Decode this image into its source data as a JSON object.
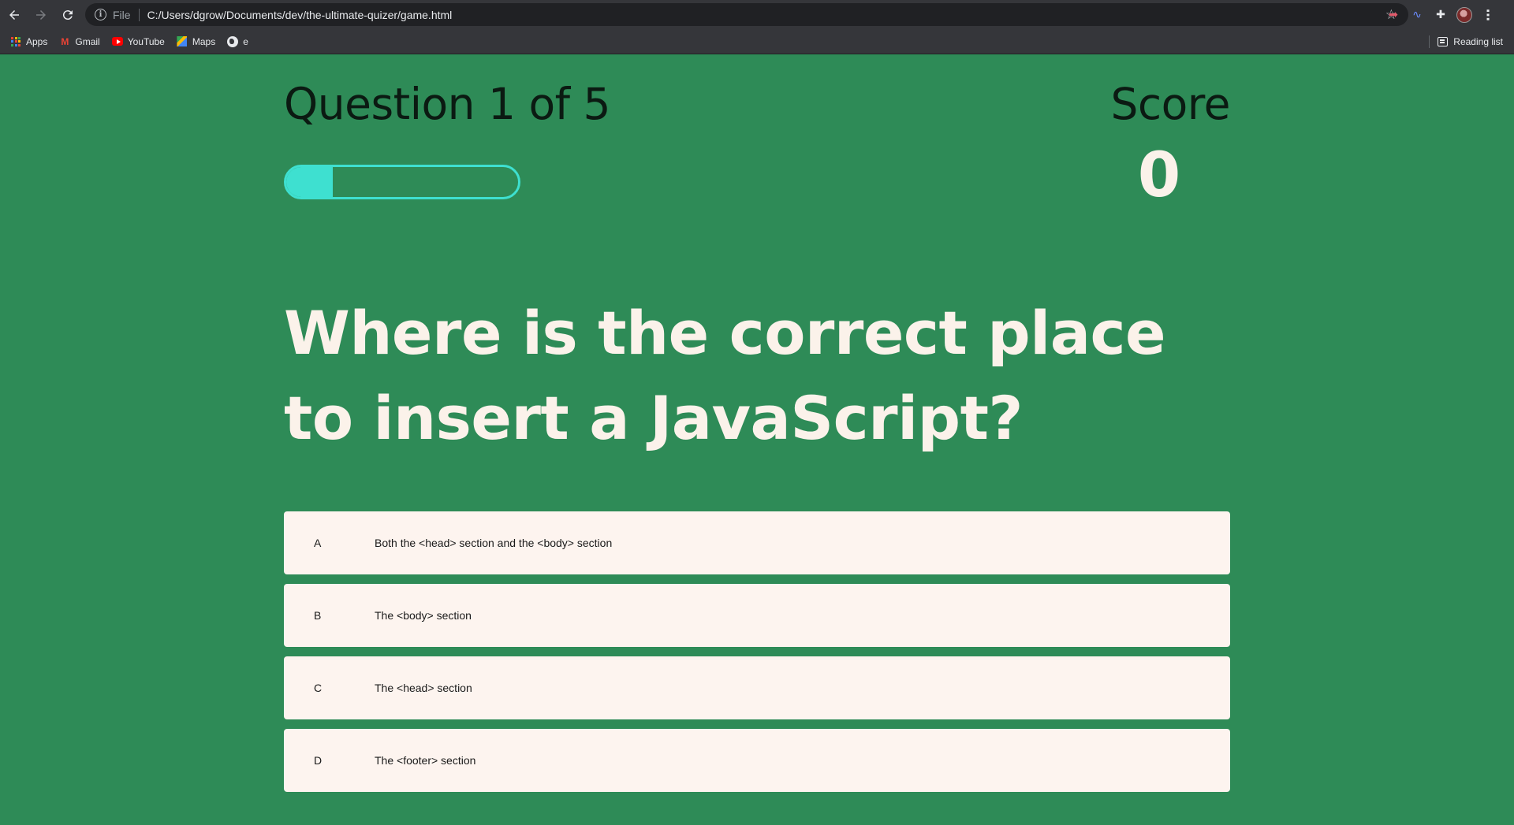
{
  "browser": {
    "url_scheme_label": "File",
    "url": "C:/Users/dgrow/Documents/dev/the-ultimate-quizer/game.html",
    "bookmarks": [
      {
        "label": "Apps",
        "icon": "apps-grid-icon"
      },
      {
        "label": "Gmail",
        "icon": "gmail-icon"
      },
      {
        "label": "YouTube",
        "icon": "youtube-icon"
      },
      {
        "label": "Maps",
        "icon": "maps-icon"
      },
      {
        "label": "e",
        "icon": "globe-icon"
      }
    ],
    "reading_list_label": "Reading list"
  },
  "hud": {
    "question_counter": "Question 1 of 5",
    "score_label": "Score",
    "score_value": "0",
    "progress_fraction": 0.2
  },
  "question": {
    "text": "Where is the correct place to insert a JavaScript?"
  },
  "choices": [
    {
      "prefix": "A",
      "text": "Both the <head> section and the <body> section"
    },
    {
      "prefix": "B",
      "text": "The <body> section"
    },
    {
      "prefix": "C",
      "text": "The <head> section"
    },
    {
      "prefix": "D",
      "text": "The <footer> section"
    }
  ],
  "colors": {
    "page_background": "#2e8b57",
    "progress_accent": "#3ee0d0",
    "light_text": "#fbf2ea",
    "choice_background": "#fdf4ef"
  }
}
